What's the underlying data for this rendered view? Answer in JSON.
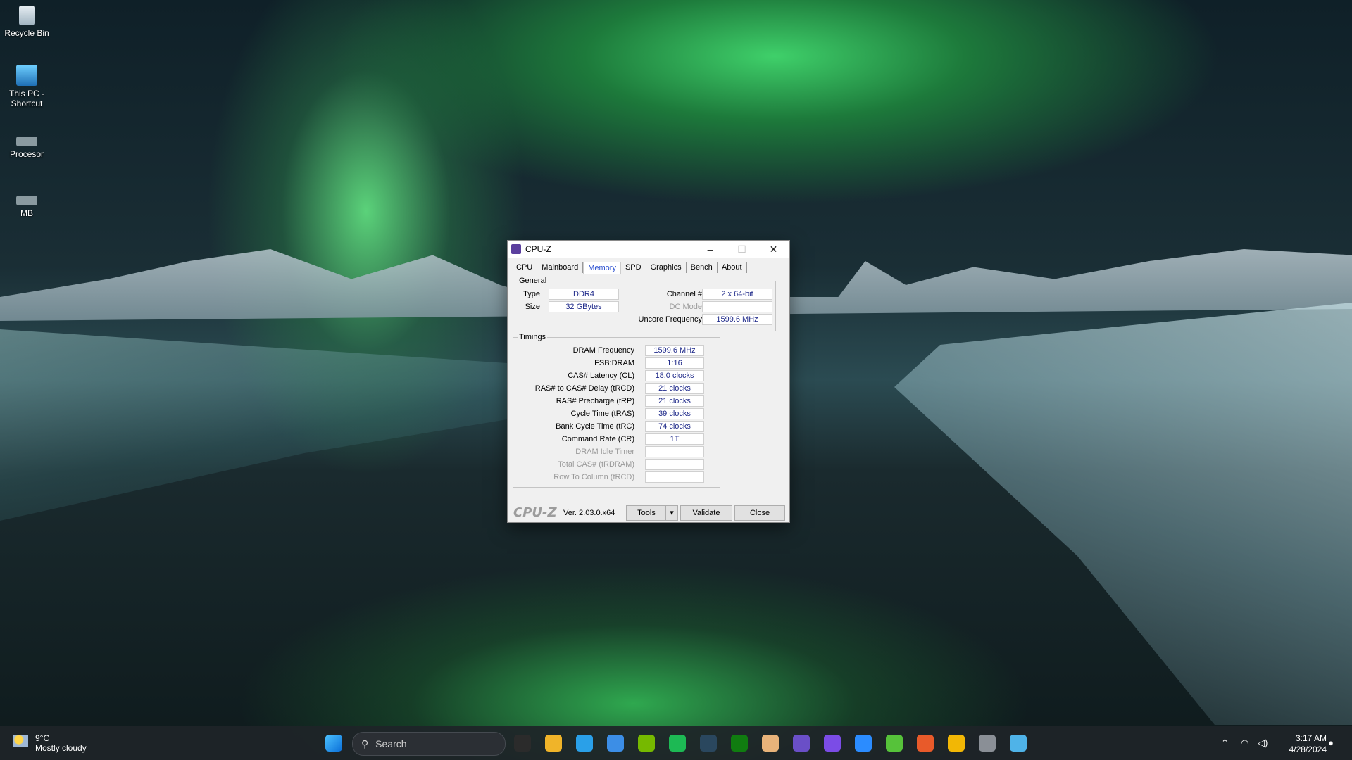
{
  "desktop": {
    "icons": [
      {
        "label": "Recycle Bin",
        "icon": "recycle-bin-icon"
      },
      {
        "label": "This PC - Shortcut",
        "icon": "computer-icon"
      },
      {
        "label": "Procesor",
        "icon": "cpu-chip-icon"
      },
      {
        "label": "MB",
        "icon": "motherboard-icon"
      }
    ]
  },
  "window": {
    "title": "CPU-Z",
    "tabs": [
      "CPU",
      "Mainboard",
      "Memory",
      "SPD",
      "Graphics",
      "Bench",
      "About"
    ],
    "active_tab": "Memory",
    "general": {
      "label": "General",
      "type_label": "Type",
      "type_value": "DDR4",
      "size_label": "Size",
      "size_value": "32 GBytes",
      "channel_label": "Channel #",
      "channel_value": "2 x 64-bit",
      "dcmode_label": "DC Mode",
      "dcmode_value": "",
      "uncore_label": "Uncore Frequency",
      "uncore_value": "1599.6 MHz"
    },
    "timings": {
      "label": "Timings",
      "rows": [
        {
          "label": "DRAM Frequency",
          "value": "1599.6 MHz",
          "dim": false
        },
        {
          "label": "FSB:DRAM",
          "value": "1:16",
          "dim": false
        },
        {
          "label": "CAS# Latency (CL)",
          "value": "18.0 clocks",
          "dim": false
        },
        {
          "label": "RAS# to CAS# Delay (tRCD)",
          "value": "21 clocks",
          "dim": false
        },
        {
          "label": "RAS# Precharge (tRP)",
          "value": "21 clocks",
          "dim": false
        },
        {
          "label": "Cycle Time (tRAS)",
          "value": "39 clocks",
          "dim": false
        },
        {
          "label": "Bank Cycle Time (tRC)",
          "value": "74 clocks",
          "dim": false
        },
        {
          "label": "Command Rate (CR)",
          "value": "1T",
          "dim": false
        },
        {
          "label": "DRAM Idle Timer",
          "value": "",
          "dim": true
        },
        {
          "label": "Total CAS# (tRDRAM)",
          "value": "",
          "dim": true
        },
        {
          "label": "Row To Column (tRCD)",
          "value": "",
          "dim": true
        }
      ]
    },
    "footer": {
      "logo": "CPU-Z",
      "version": "Ver. 2.03.0.x64",
      "tools": "Tools",
      "validate": "Validate",
      "close": "Close"
    }
  },
  "taskbar": {
    "weather_temp": "9°C",
    "weather_desc": "Mostly cloudy",
    "search_placeholder": "Search",
    "time": "3:17 AM",
    "date": "4/28/2024",
    "apps": [
      "windows-start-icon",
      "epic-games-icon",
      "file-explorer-icon",
      "edge-icon",
      "store-icon",
      "nvidia-icon",
      "spotify-like-icon",
      "steam-icon",
      "xbox-icon",
      "hwinfo-icon",
      "cpuz-icon",
      "visual-studio-icon",
      "bolt-icon",
      "utorrent-icon",
      "ea-icon",
      "chrome-icon",
      "settings-icon",
      "globe-icon"
    ]
  }
}
